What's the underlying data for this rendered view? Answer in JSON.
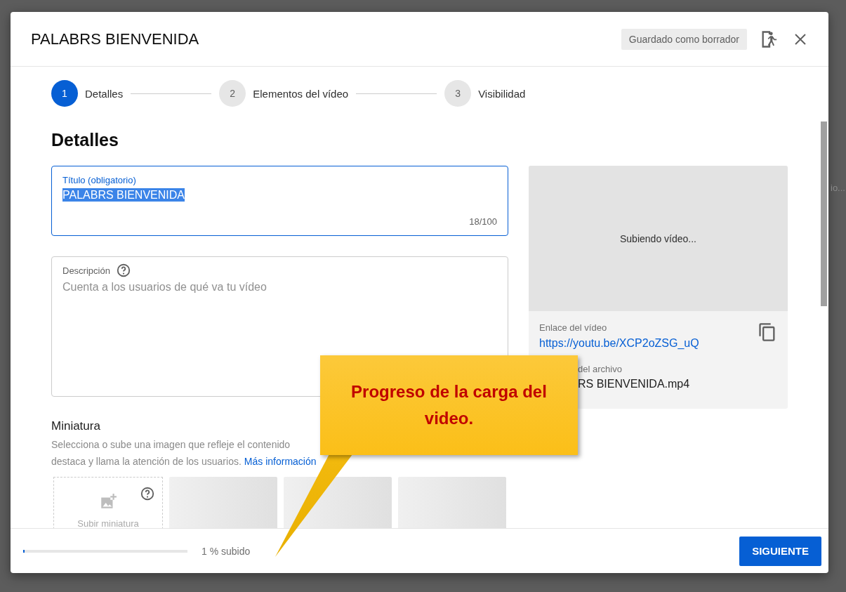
{
  "background": {
    "fragment": "io..."
  },
  "dialog": {
    "title": "PALABRS BIENVENIDA",
    "save_status": "Guardado como borrador"
  },
  "steps": [
    {
      "number": "1",
      "label": "Detalles",
      "selected": true
    },
    {
      "number": "2",
      "label": "Elementos del vídeo",
      "selected": false
    },
    {
      "number": "3",
      "label": "Visibilidad",
      "selected": false
    }
  ],
  "section_title": "Detalles",
  "title_field": {
    "label": "Título (obligatorio)",
    "value": "PALABRS BIENVENIDA",
    "selected": true,
    "counter": "18/100"
  },
  "description_field": {
    "label": "Descripción",
    "placeholder": "Cuenta a los usuarios de qué va tu vídeo"
  },
  "thumbnail": {
    "heading": "Miniatura",
    "text_line_1": "Selecciona o sube una imagen que refleje el contenido",
    "text_line_2": "destaca y llama la atención de los usuarios.",
    "link": "Más información",
    "upload_label": "Subir miniatura"
  },
  "preview": {
    "status": "Subiendo vídeo...",
    "link_label": "Enlace del vídeo",
    "link": "https://youtu.be/XCP2oZSG_uQ",
    "file_label": "del archivo",
    "file_name": "RS BIENVENIDA.mp4"
  },
  "footer": {
    "progress": {
      "level": 0.01
    },
    "progress_text": "1 % subido",
    "next_button": "SIGUIENTE"
  },
  "callout": {
    "text": "Progreso de la carga del video."
  }
}
